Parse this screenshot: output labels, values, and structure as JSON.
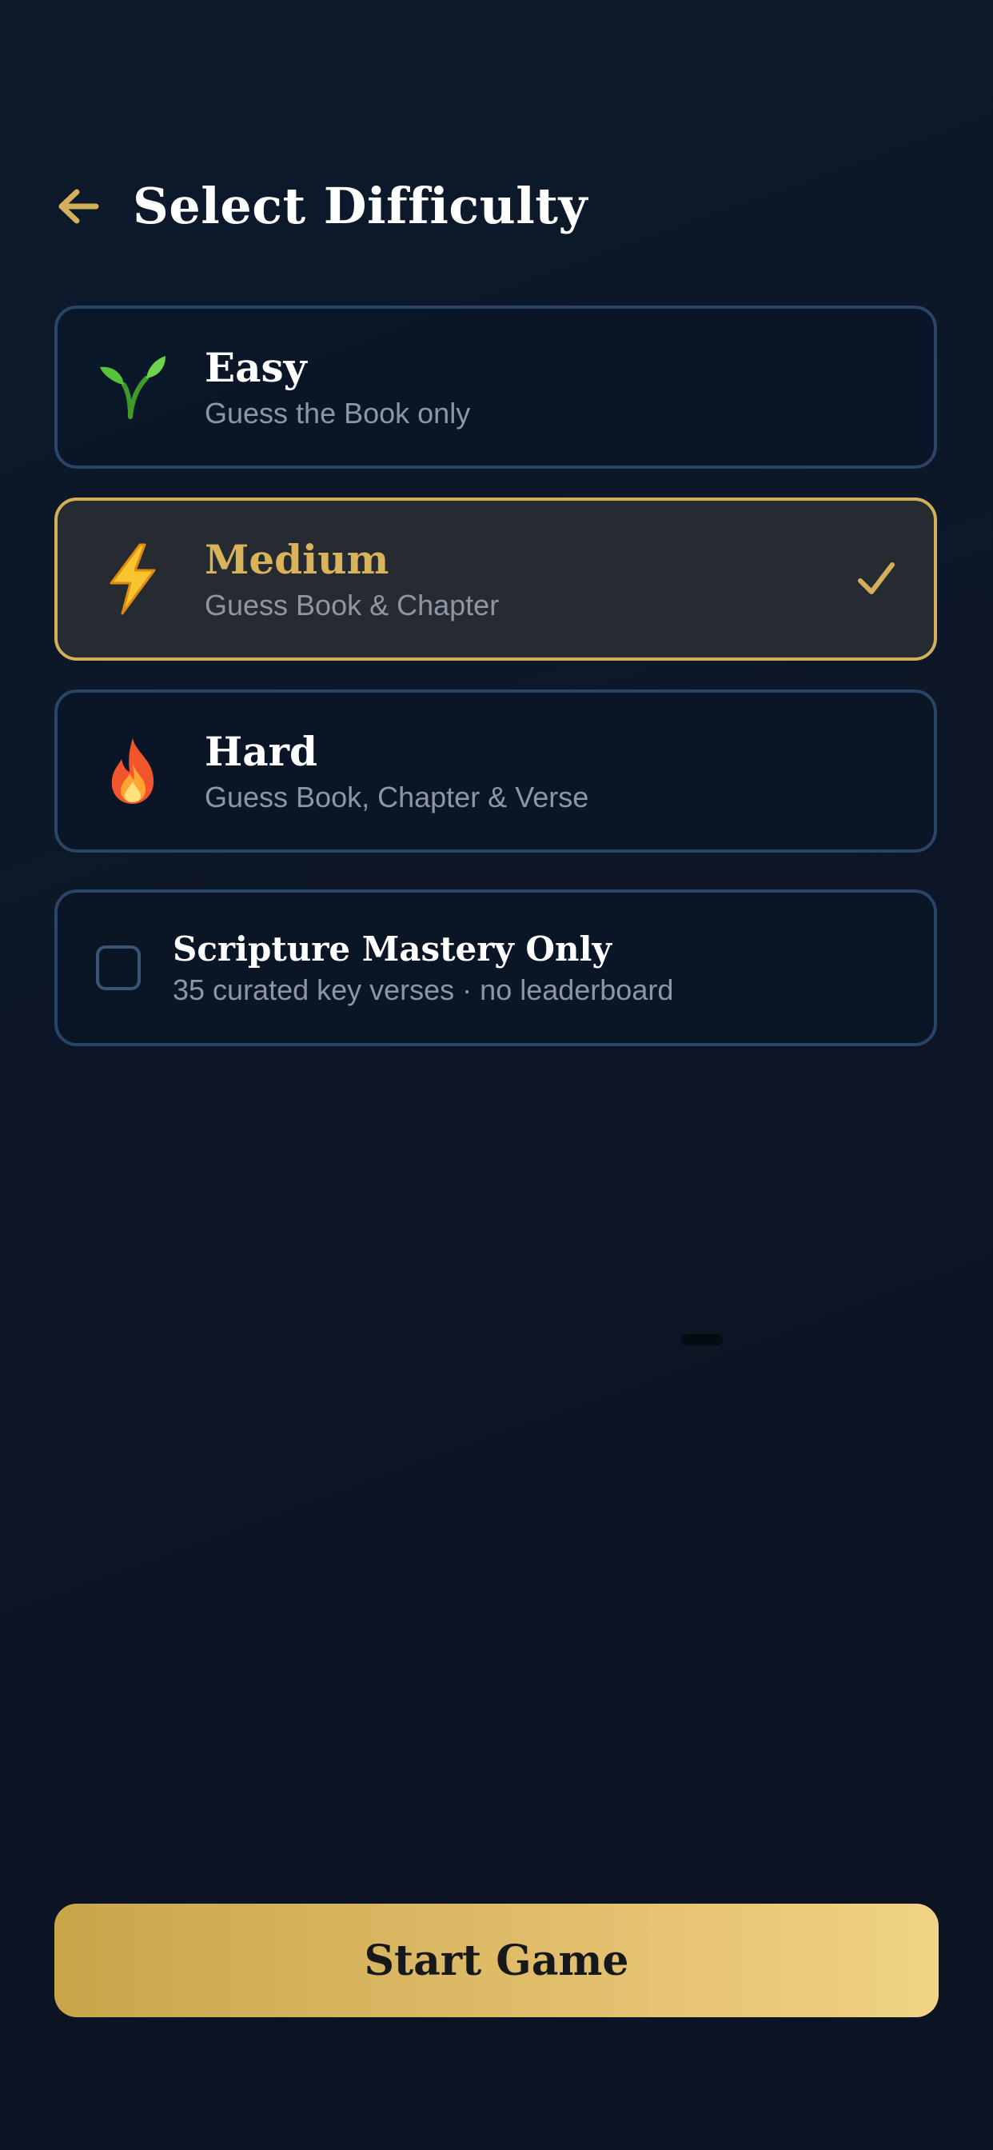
{
  "header": {
    "title": "Select Difficulty",
    "back_icon": "arrow-left-icon"
  },
  "difficulties": [
    {
      "title": "Easy",
      "subtitle": "Guess the Book only",
      "icon": "seedling-icon",
      "selected": false
    },
    {
      "title": "Medium",
      "subtitle": "Guess Book & Chapter",
      "icon": "lightning-icon",
      "selected": true
    },
    {
      "title": "Hard",
      "subtitle": "Guess Book, Chapter & Verse",
      "icon": "fire-icon",
      "selected": false
    }
  ],
  "mastery": {
    "title": "Scripture Mastery Only",
    "subtitle": "35 curated key verses · no leaderboard",
    "checked": false
  },
  "start_button": {
    "label": "Start Game"
  },
  "colors": {
    "accent": "#d4af5a",
    "background": "#0c1a2b",
    "card_border": "#2a4568",
    "muted_text": "#8e96a3"
  }
}
